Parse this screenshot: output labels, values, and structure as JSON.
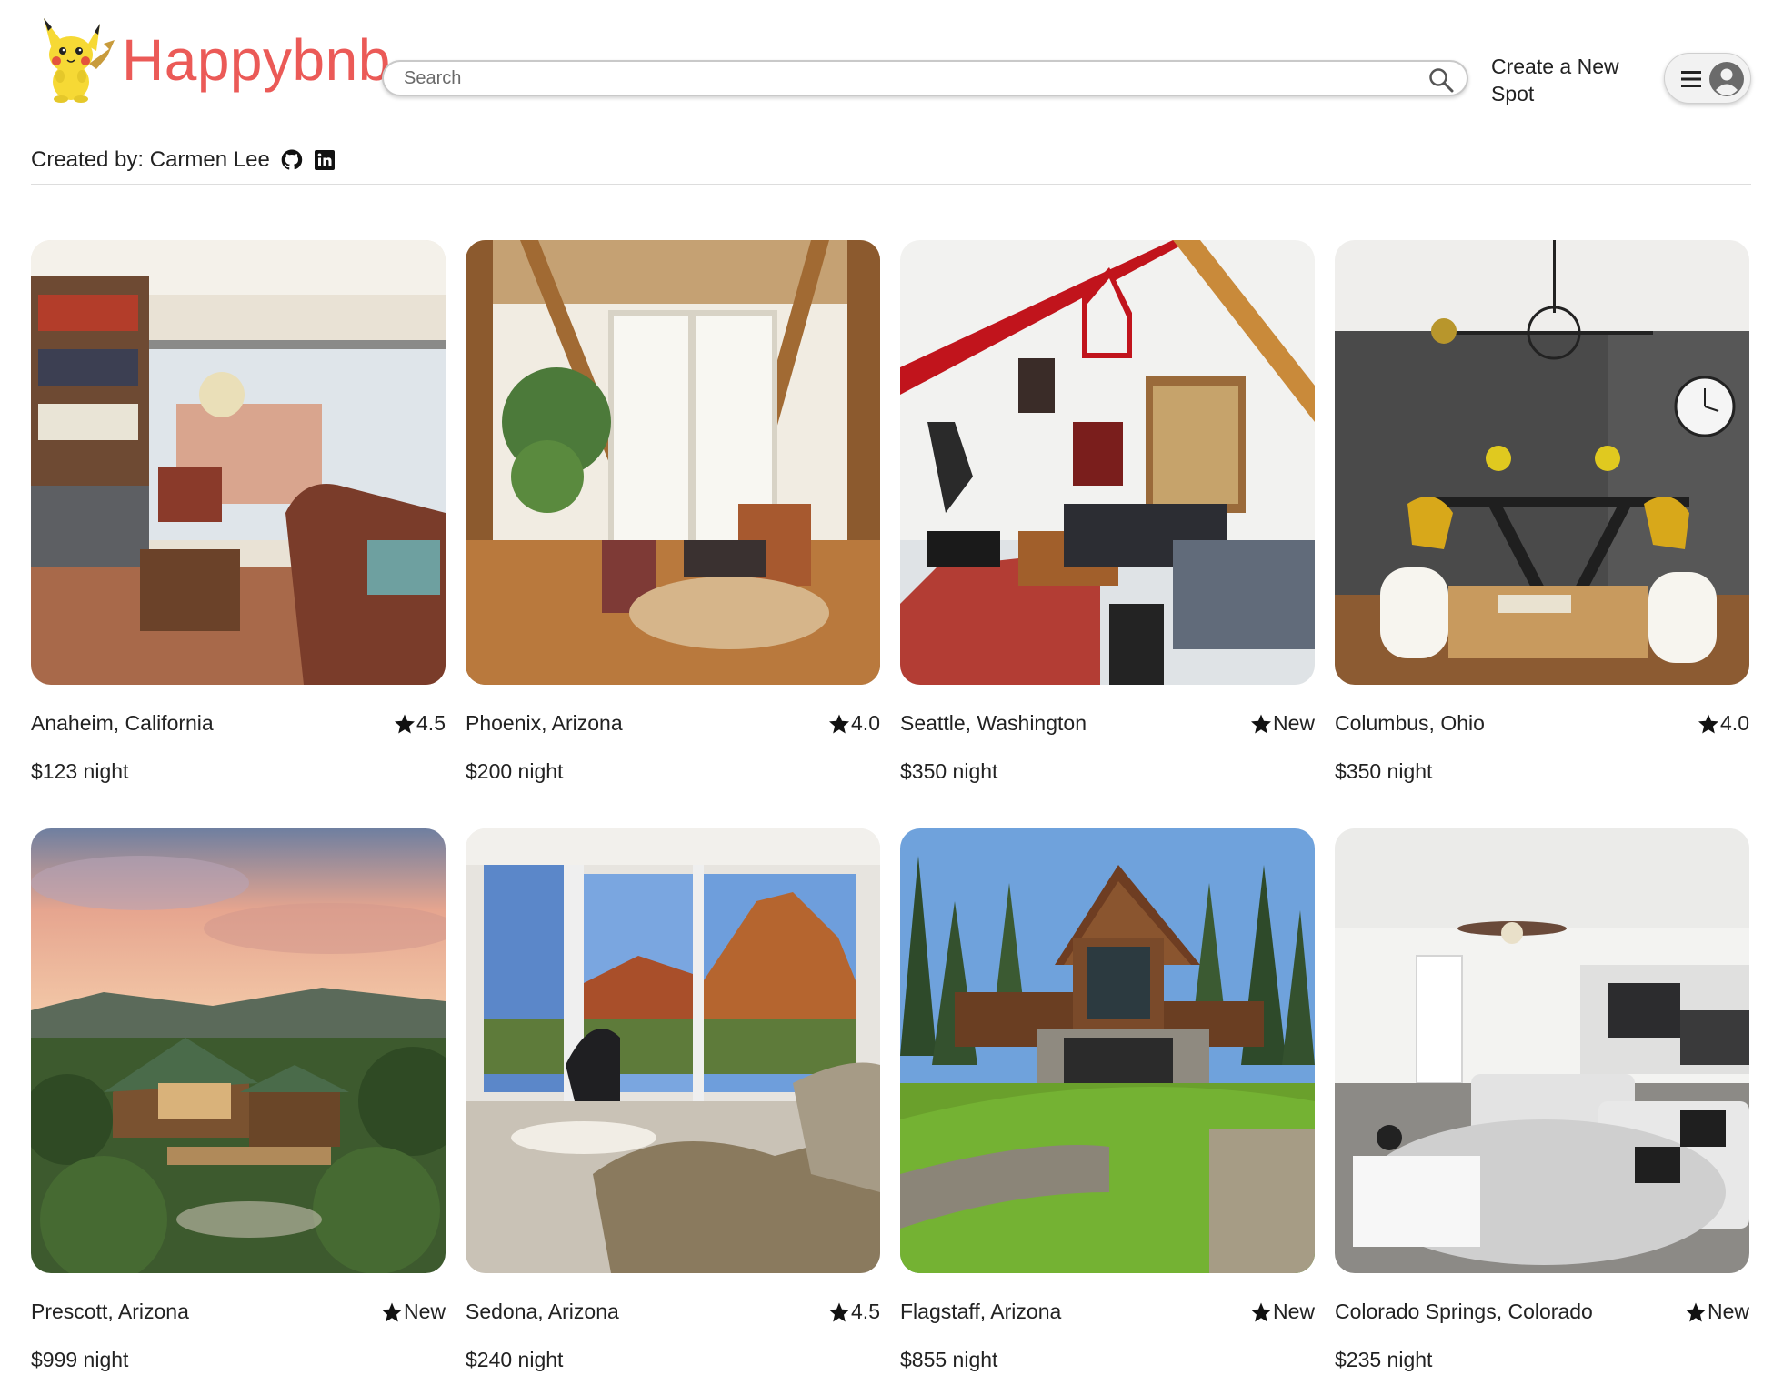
{
  "header": {
    "logo_text": "Happybnb",
    "search": {
      "placeholder": "Search"
    },
    "create_label": "Create a New Spot"
  },
  "credits": {
    "label": "Created by: Carmen Lee"
  },
  "icons": {
    "logo": "pikachu-icon",
    "search": "search-icon",
    "menu": "hamburger-icon",
    "user": "user-avatar-icon",
    "github": "github-icon",
    "linkedin": "linkedin-icon",
    "rating": "star-icon"
  },
  "colors": {
    "brand": "#eb5a57",
    "text": "#222222",
    "divider": "#dddddd"
  },
  "spots": [
    {
      "city": "Anaheim, California",
      "rating": "4.5",
      "price": "$123 night"
    },
    {
      "city": "Phoenix, Arizona",
      "rating": "4.0",
      "price": "$200 night"
    },
    {
      "city": "Seattle, Washington",
      "rating": "New",
      "price": "$350 night"
    },
    {
      "city": "Columbus, Ohio",
      "rating": "4.0",
      "price": "$350 night"
    },
    {
      "city": "Prescott, Arizona",
      "rating": "New",
      "price": "$999 night"
    },
    {
      "city": "Sedona, Arizona",
      "rating": "4.5",
      "price": "$240 night"
    },
    {
      "city": "Flagstaff, Arizona",
      "rating": "New",
      "price": "$855 night"
    },
    {
      "city": "Colorado Springs, Colorado",
      "rating": "New",
      "price": "$235 night"
    }
  ]
}
